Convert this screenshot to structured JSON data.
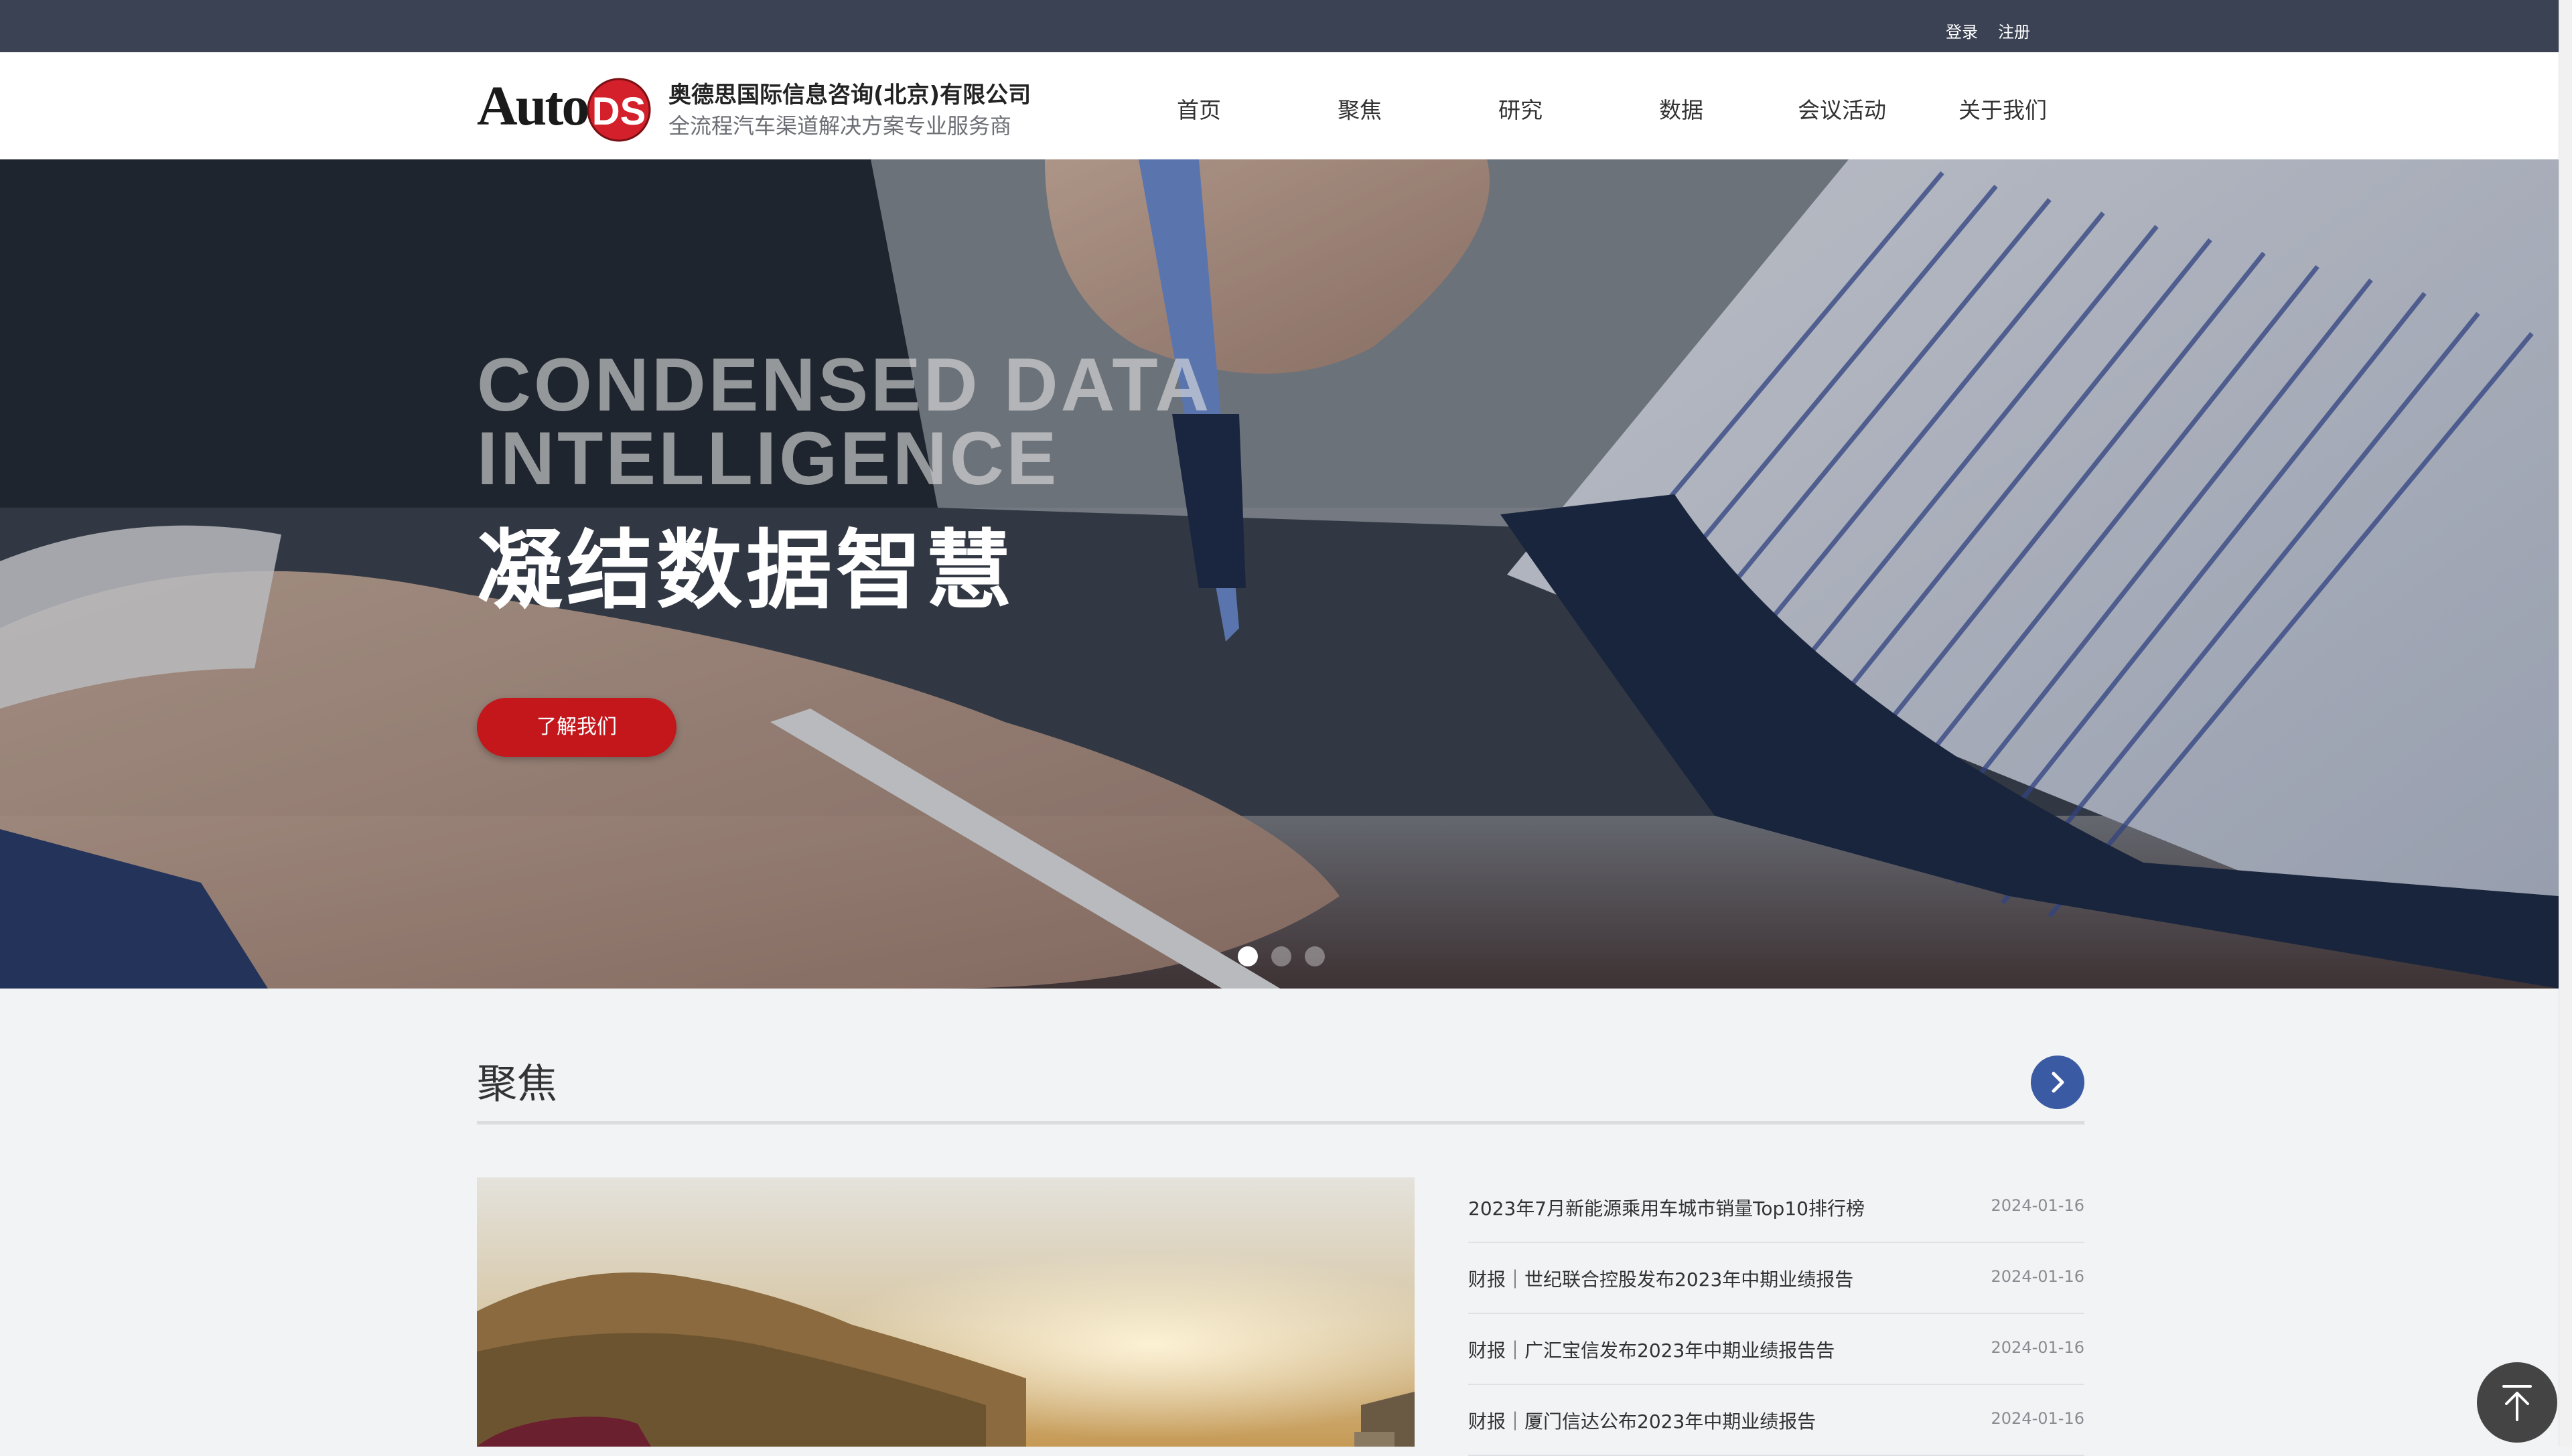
{
  "topbar": {
    "login": "登录",
    "register": "注册"
  },
  "header": {
    "logo_alt": "AutoDS",
    "company_name": "奥德思国际信息咨询(北京)有限公司",
    "tagline": "全流程汽车渠道解决方案专业服务商",
    "nav": [
      "首页",
      "聚焦",
      "研究",
      "数据",
      "会议活动",
      "关于我们"
    ]
  },
  "hero": {
    "en_line1": "CONDENSED DATA",
    "en_line2": "INTELLIGENCE",
    "cn": "凝结数据智慧",
    "button": "了解我们",
    "slides": 3,
    "active_slide": 1
  },
  "focus": {
    "title": "聚焦",
    "news": [
      {
        "title": "2023年7月新能源乘用车城市销量Top10排行榜",
        "date": "2024-01-16"
      },
      {
        "title": "财报｜世纪联合控股发布2023年中期业绩报告",
        "date": "2024-01-16"
      },
      {
        "title": "财报｜广汇宝信发布2023年中期业绩报告告",
        "date": "2024-01-16"
      },
      {
        "title": "财报｜厦门信达公布2023年中期业绩报告",
        "date": "2024-01-16"
      }
    ]
  },
  "colors": {
    "topbar": "#3b4253",
    "accent_red": "#c3171c",
    "accent_blue": "#3a5aa4"
  },
  "icons": {
    "more": "chevron-right-icon",
    "back_top": "arrow-up-icon"
  }
}
